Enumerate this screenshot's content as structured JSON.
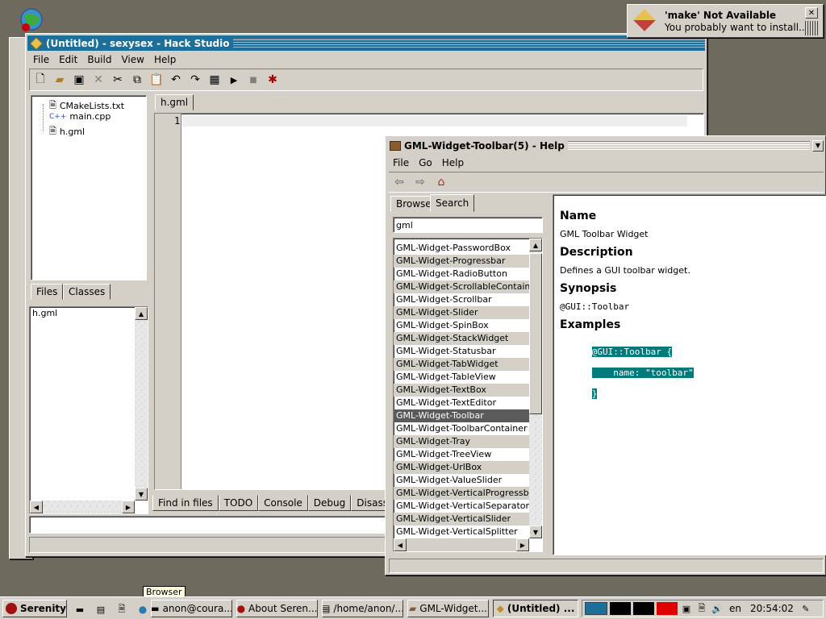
{
  "notification": {
    "title": "'make' Not Available",
    "message": "You probably want to install..."
  },
  "hack_studio": {
    "title": "(Untitled) - sexysex - Hack Studio",
    "menu": [
      "File",
      "Edit",
      "Build",
      "View",
      "Help"
    ],
    "files": [
      "CMakeLists.txt",
      "main.cpp",
      "h.gml"
    ],
    "left_tabs": [
      "Files",
      "Classes"
    ],
    "open_file": "h.gml",
    "editor_tab": "h.gml",
    "line_number": "1",
    "bottom_tabs": [
      "Find in files",
      "TODO",
      "Console",
      "Debug",
      "Disassem"
    ]
  },
  "help": {
    "title": "GML-Widget-Toolbar(5) - Help",
    "menu": [
      "File",
      "Go",
      "Help"
    ],
    "tabs": [
      "Browse",
      "Search"
    ],
    "search_value": "gml",
    "results": [
      "GML-Widget-PasswordBox",
      "GML-Widget-Progressbar",
      "GML-Widget-RadioButton",
      "GML-Widget-ScrollableContaine",
      "GML-Widget-Scrollbar",
      "GML-Widget-Slider",
      "GML-Widget-SpinBox",
      "GML-Widget-StackWidget",
      "GML-Widget-Statusbar",
      "GML-Widget-TabWidget",
      "GML-Widget-TableView",
      "GML-Widget-TextBox",
      "GML-Widget-TextEditor",
      "GML-Widget-Toolbar",
      "GML-Widget-ToolbarContainer",
      "GML-Widget-Tray",
      "GML-Widget-TreeView",
      "GML-Widget-UrlBox",
      "GML-Widget-ValueSlider",
      "GML-Widget-VerticalProgressbar",
      "GML-Widget-VerticalSeparator",
      "GML-Widget-VerticalSlider",
      "GML-Widget-VerticalSplitter"
    ],
    "selected_index": 13,
    "doc": {
      "h_name": "Name",
      "name": "GML Toolbar Widget",
      "h_description": "Description",
      "description": "Defines a GUI toolbar widget.",
      "h_synopsis": "Synopsis",
      "synopsis": "@GUI::Toolbar",
      "h_examples": "Examples",
      "code": [
        "@GUI::Toolbar {",
        "    name: \"toolbar\"",
        "}"
      ]
    }
  },
  "tooltip": "Browser",
  "taskbar": {
    "start": "Serenity",
    "tasks": [
      "anon@coura...",
      "About Seren...",
      "/home/anon/...",
      "GML-Widget...",
      "(Untitled) ..."
    ],
    "lang": "en",
    "clock": "20:54:02"
  },
  "colors": {
    "desktop": "#6f6a5e",
    "title_active": "#1b6f9a",
    "selection": "#5a5a5a",
    "code_bg": "#007b7b"
  }
}
